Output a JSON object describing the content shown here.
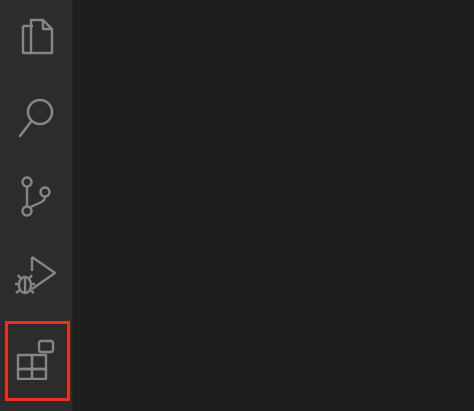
{
  "activity_bar": {
    "items": [
      {
        "icon": "files-icon",
        "label": ""
      },
      {
        "icon": "search-icon",
        "label": ""
      },
      {
        "icon": "source-control-icon",
        "label": ""
      },
      {
        "icon": "run-debug-icon",
        "label": ""
      },
      {
        "icon": "extensions-icon",
        "label": "",
        "highlighted": true
      }
    ],
    "icon_color": "#858585",
    "background": "#2c2c2c",
    "highlight_color": "#e8321f"
  },
  "editor": {
    "background": "#1e1e1e"
  }
}
